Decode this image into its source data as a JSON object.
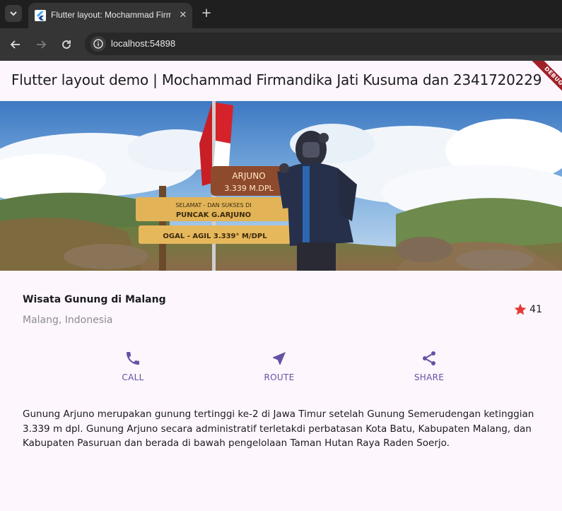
{
  "browser": {
    "tab_title": "Flutter layout: Mochammad Firm",
    "url": "localhost:54898"
  },
  "app": {
    "appbar_title": "Flutter layout demo | Mochammad Firmandika Jati Kusuma dan 2341720229",
    "debug_label": "DEBUG",
    "sign": {
      "summit_name": "ARJUNO",
      "summit_height": "3.339 M.DPL",
      "welcome_line1": "SELAMAT - DAN  SUKSES DI",
      "welcome_line2": "PUNCAK  G.ARJUNO",
      "ogal_agil": "OGAL - AGIL 3.339° M/DPL"
    },
    "title_section": {
      "name": "Wisata Gunung di Malang",
      "location": "Malang, Indonesia",
      "rating": "41"
    },
    "actions": [
      {
        "label": "CALL",
        "icon": "call-icon"
      },
      {
        "label": "ROUTE",
        "icon": "near-me-icon"
      },
      {
        "label": "SHARE",
        "icon": "share-icon"
      }
    ],
    "description": "Gunung Arjuno merupakan gunung tertinggi ke-2 di Jawa Timur setelah Gunung Semerudengan ketinggian 3.339 m dpl. Gunung Arjuno secara administratif terletakdi perbatasan Kota Batu, Kabupaten Malang, dan Kabupaten Pasuruan dan berada di bawah pengelolaan Taman Hutan Raya Raden Soerjo."
  },
  "colors": {
    "primary": "#6750a4",
    "star": "#e53935",
    "background": "#fdf6fd"
  }
}
